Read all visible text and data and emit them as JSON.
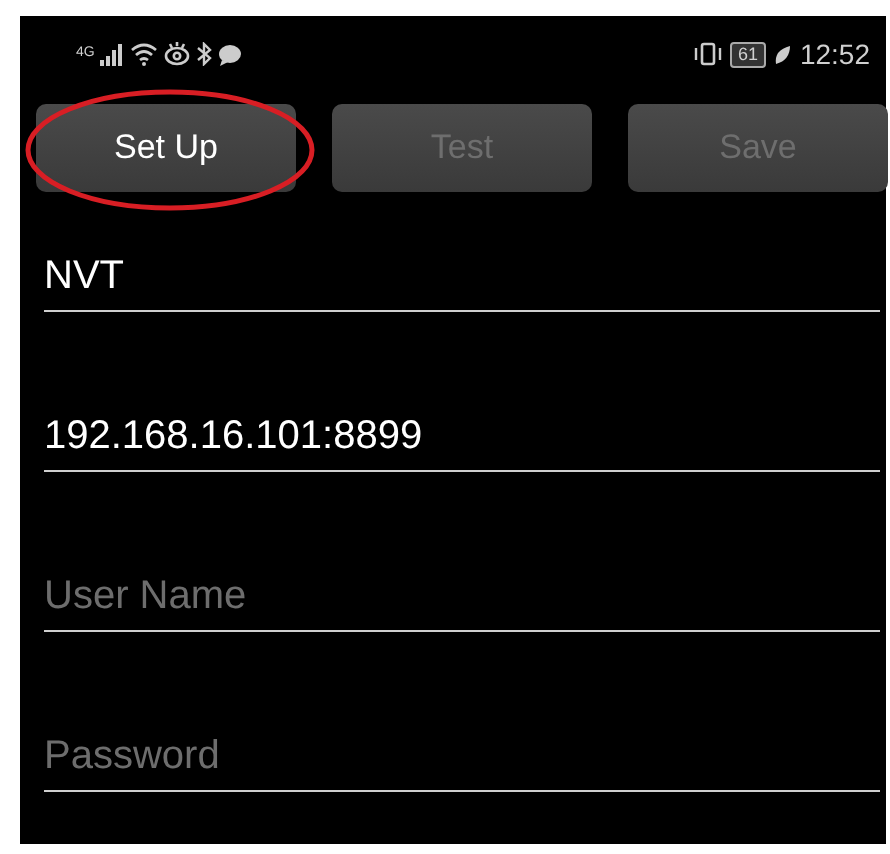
{
  "status_bar": {
    "network": "4G",
    "battery": "61",
    "time": "12:52"
  },
  "buttons": [
    {
      "label": "Set Up",
      "disabled": false,
      "highlighted": true
    },
    {
      "label": "Test",
      "disabled": true,
      "highlighted": false
    },
    {
      "label": "Save",
      "disabled": true,
      "highlighted": false
    }
  ],
  "fields": [
    {
      "value": "NVT"
    },
    {
      "value": "192.168.16.101:8899"
    },
    {
      "placeholder": "User Name"
    },
    {
      "placeholder": "Password"
    }
  ]
}
